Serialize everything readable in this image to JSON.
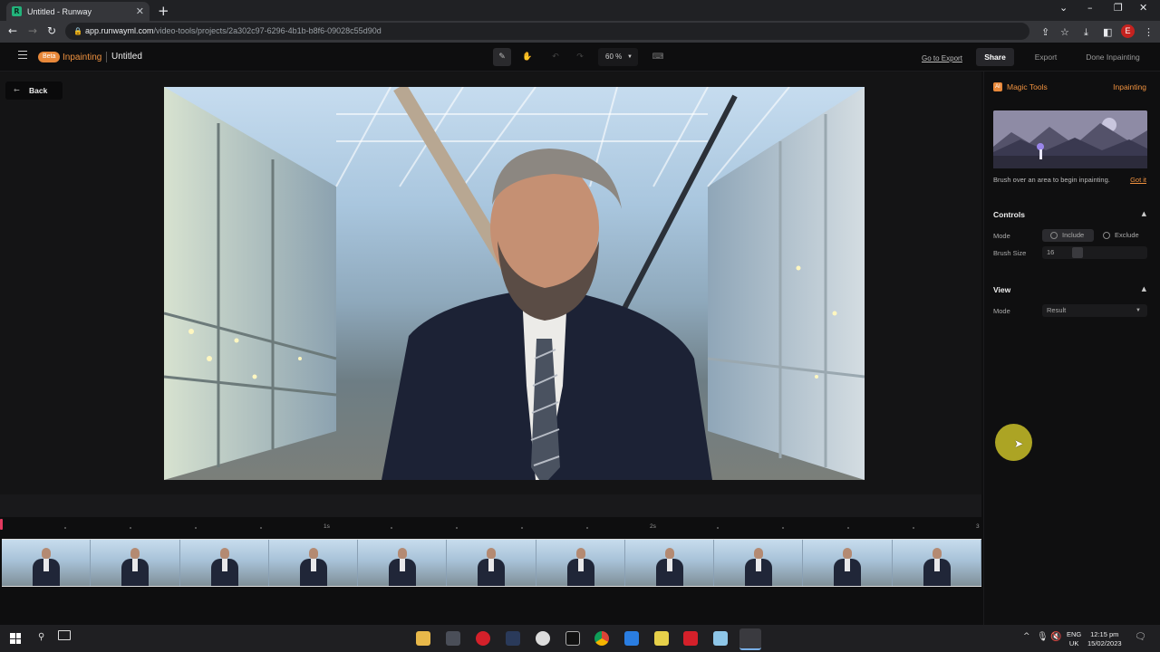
{
  "browser": {
    "tab_title": "Untitled - Runway",
    "tab_favicon": "R",
    "url_host": "app.runwayml.com",
    "url_path": "/video-tools/projects/2a302c97-6296-4b1b-b8f6-09028c55d90d",
    "profile_initial": "E"
  },
  "header": {
    "beta_badge": "Beta",
    "tool_name": "Inpainting",
    "project_name": "Untitled",
    "zoom": "60 %",
    "go_to_export": "Go to Export",
    "share": "Share",
    "export": "Export",
    "done": "Done Inpainting"
  },
  "workspace": {
    "back": "Back"
  },
  "panel": {
    "magic_tools_icon": "AI",
    "magic_tools": "Magic Tools",
    "current_tool": "Inpainting",
    "tip_text": "Brush over an area to begin inpainting.",
    "tip_dismiss": "Got it",
    "controls": {
      "title": "Controls",
      "mode_label": "Mode",
      "include": "Include",
      "exclude": "Exclude",
      "brush_size_label": "Brush Size",
      "brush_size_value": "16"
    },
    "view": {
      "title": "View",
      "mode_label": "Mode",
      "mode_value": "Result"
    }
  },
  "timeline": {
    "labels": [
      "1s",
      "2s",
      "3"
    ]
  },
  "taskbar": {
    "lang_line1": "ENG",
    "lang_line2": "UK",
    "time": "12:15 pm",
    "date": "15/02/2023"
  },
  "colors": {
    "accent": "#f0923f",
    "playhead": "#e33a5f",
    "cursor_highlight": "#c8be28"
  },
  "icons": [
    "pen-icon",
    "hand-icon",
    "undo-icon",
    "redo-icon",
    "keyboard-icon",
    "menu-icon",
    "arrow-left-icon",
    "chevron-up-icon",
    "chevron-down-icon"
  ]
}
